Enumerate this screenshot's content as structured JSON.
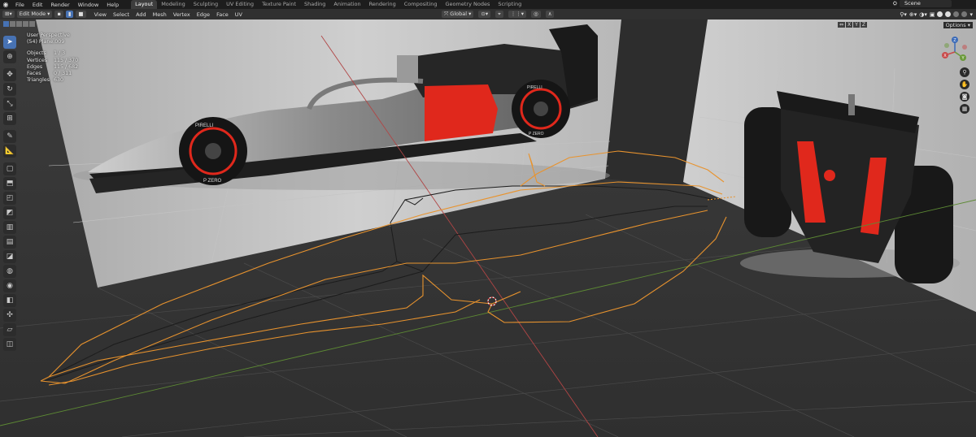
{
  "menu": [
    "File",
    "Edit",
    "Render",
    "Window",
    "Help"
  ],
  "workspaces": [
    "Layout",
    "Modeling",
    "Sculpting",
    "UV Editing",
    "Texture Paint",
    "Shading",
    "Animation",
    "Rendering",
    "Compositing",
    "Geometry Nodes",
    "Scripting"
  ],
  "active_workspace": "Layout",
  "scene_label": "Scene",
  "header": {
    "mode": "Edit Mode",
    "menus": [
      "View",
      "Select",
      "Add",
      "Mesh",
      "Vertex",
      "Edge",
      "Face",
      "UV"
    ],
    "transform_orientation": "Global"
  },
  "viewport": {
    "view_name": "User Perspective",
    "object_name": "(54) Plane.009",
    "stats": [
      {
        "label": "Objects",
        "value": "1 / 3"
      },
      {
        "label": "Vertices",
        "value": "115 / 370"
      },
      {
        "label": "Edges",
        "value": "115 / 682"
      },
      {
        "label": "Faces",
        "value": "0 / 311"
      },
      {
        "label": "Triangles",
        "value": "630"
      }
    ],
    "mirror_axes": [
      "X",
      "Y",
      "Z"
    ],
    "options_label": "Options",
    "side_decal_1": "PIRELLI",
    "side_decal_2": "P ZERO"
  },
  "gizmo": {
    "x": "X",
    "y": "Y",
    "z": "Z"
  },
  "colors": {
    "accent": "#4772b3",
    "selected_edge": "#e8932e",
    "axis_x": "#c84a4a",
    "axis_y": "#6a9a3a",
    "car_red": "#e0281c"
  }
}
